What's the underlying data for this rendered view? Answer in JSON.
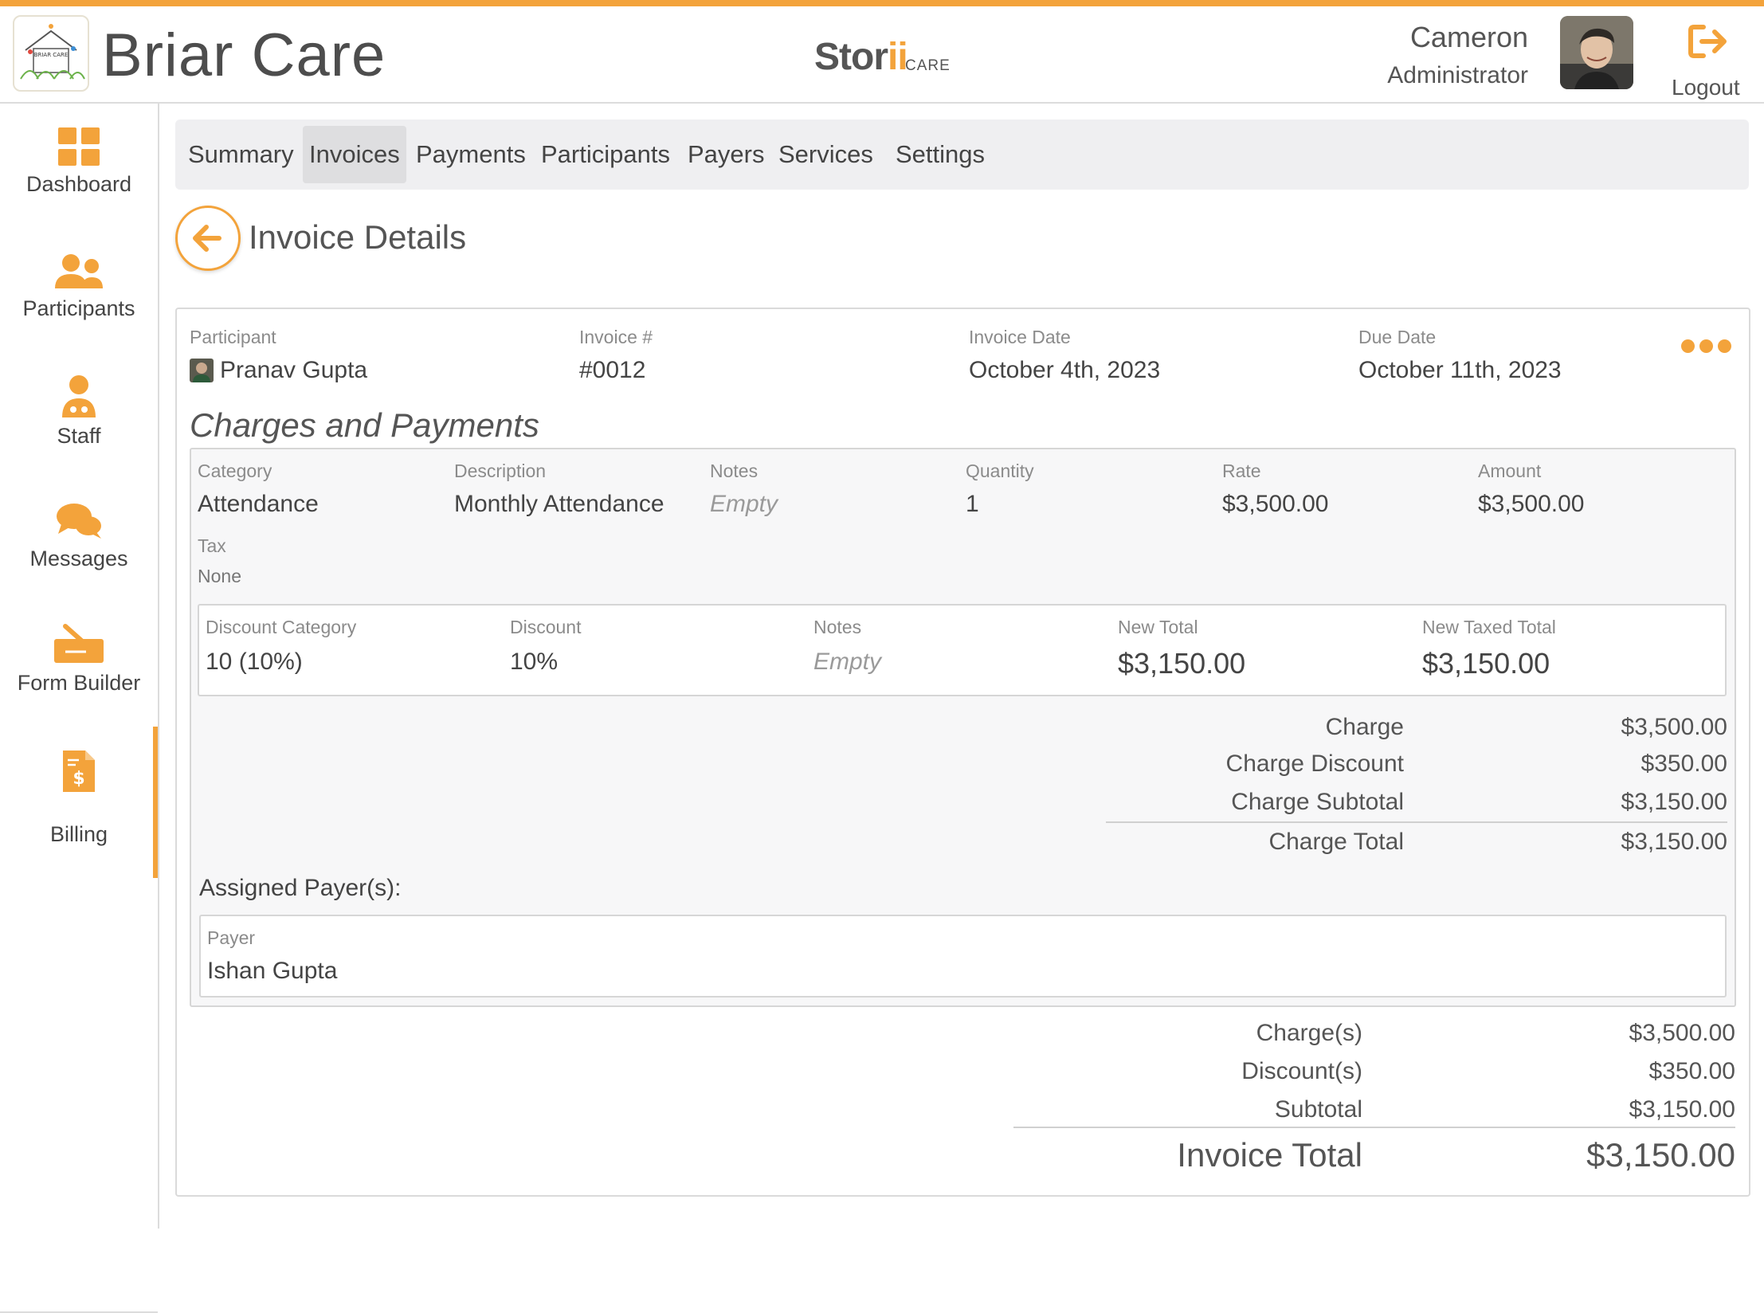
{
  "app": {
    "title": "Briar Care",
    "brand": "Storii",
    "brand_sub": "CARE",
    "logo_text": "BRIAR CARE"
  },
  "user": {
    "name": "Cameron",
    "role": "Administrator",
    "logout_label": "Logout"
  },
  "sidebar": {
    "items": [
      {
        "label": "Dashboard",
        "icon": "dashboard-grid-icon"
      },
      {
        "label": "Participants",
        "icon": "people-icon"
      },
      {
        "label": "Staff",
        "icon": "staff-icon"
      },
      {
        "label": "Messages",
        "icon": "chat-bubbles-icon"
      },
      {
        "label": "Form Builder",
        "icon": "form-builder-icon"
      },
      {
        "label": "Billing",
        "icon": "billing-document-icon",
        "active": true
      }
    ]
  },
  "tabs": [
    "Summary",
    "Invoices",
    "Payments",
    "Participants",
    "Payers",
    "Services",
    "Settings"
  ],
  "active_tab": "Invoices",
  "page": {
    "title": "Invoice Details"
  },
  "invoice": {
    "participant_label": "Participant",
    "participant": "Pranav Gupta",
    "number_label": "Invoice #",
    "number": "#0012",
    "date_label": "Invoice Date",
    "date": "October 4th, 2023",
    "due_label": "Due Date",
    "due": "October 11th, 2023"
  },
  "charges": {
    "title": "Charges and Payments",
    "headers": {
      "category": "Category",
      "description": "Description",
      "notes": "Notes",
      "quantity": "Quantity",
      "rate": "Rate",
      "amount": "Amount"
    },
    "row": {
      "category": "Attendance",
      "description": "Monthly Attendance",
      "notes": "Empty",
      "quantity": "1",
      "rate": "$3,500.00",
      "amount": "$3,500.00"
    },
    "tax_label": "Tax",
    "tax": "None",
    "discount": {
      "headers": {
        "category": "Discount Category",
        "discount": "Discount",
        "notes": "Notes",
        "new_total": "New Total",
        "new_taxed_total": "New Taxed Total"
      },
      "row": {
        "category": "10 (10%)",
        "discount": "10%",
        "notes": "Empty",
        "new_total": "$3,150.00",
        "new_taxed_total": "$3,150.00"
      }
    },
    "summary": {
      "charge_label": "Charge",
      "charge": "$3,500.00",
      "charge_discount_label": "Charge Discount",
      "charge_discount": "$350.00",
      "charge_subtotal_label": "Charge Subtotal",
      "charge_subtotal": "$3,150.00",
      "charge_total_label": "Charge Total",
      "charge_total": "$3,150.00"
    },
    "assigned_payers_label": "Assigned Payer(s):",
    "payer_label": "Payer",
    "payer": "Ishan Gupta"
  },
  "totals": {
    "charges_label": "Charge(s)",
    "charges": "$3,500.00",
    "discounts_label": "Discount(s)",
    "discounts": "$350.00",
    "subtotal_label": "Subtotal",
    "subtotal": "$3,150.00",
    "invoice_total_label": "Invoice Total",
    "invoice_total": "$3,150.00"
  },
  "colors": {
    "accent": "#f3a33b",
    "text": "#444444",
    "muted": "#8b8b8b",
    "border": "#dadada"
  }
}
